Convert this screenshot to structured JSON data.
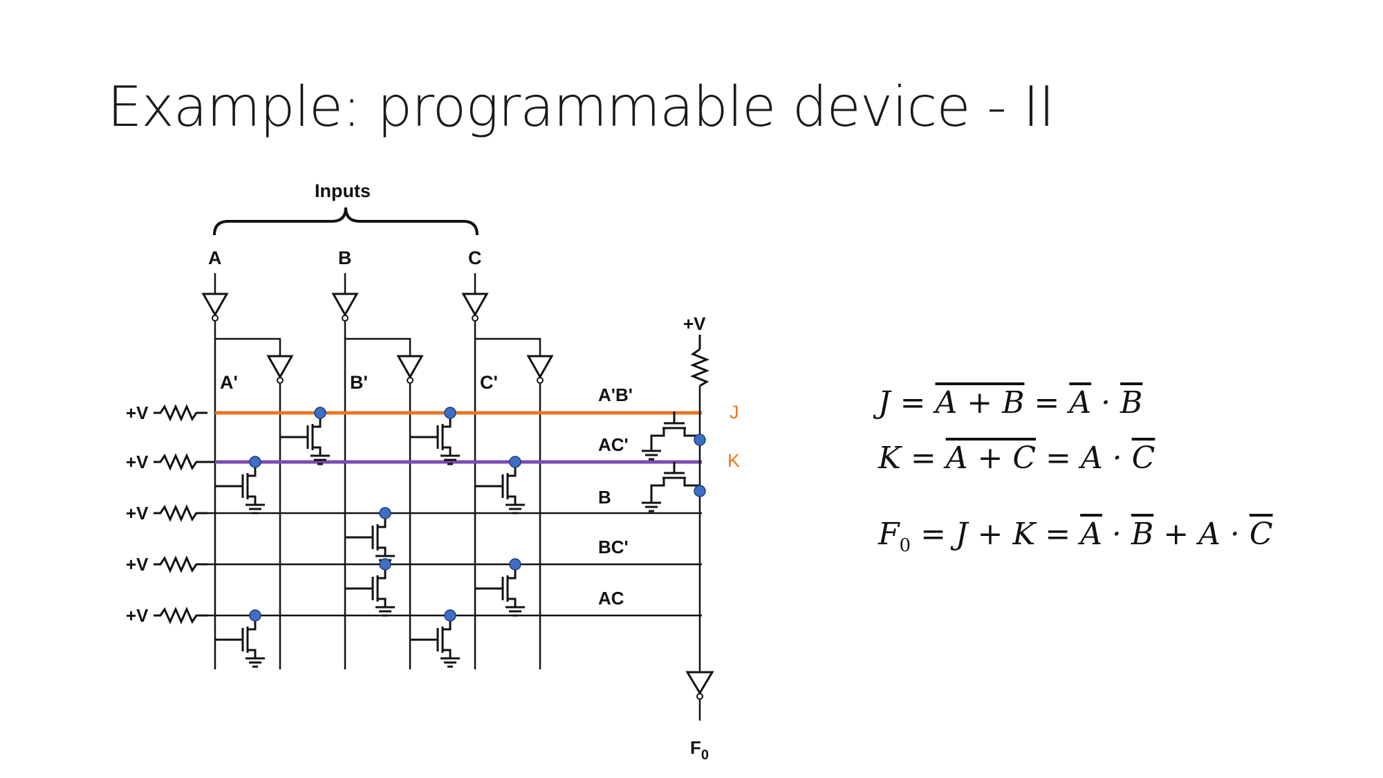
{
  "slide": {
    "title": "Example: programmable device - II"
  },
  "circuit": {
    "inputs_label": "Inputs",
    "input_names": [
      "A",
      "B",
      "C"
    ],
    "complement_names": [
      "A'",
      "B'",
      "C'"
    ],
    "supply_label": "+V",
    "output_label": "F",
    "output_subscript": "0",
    "row_labels": [
      "A'B'",
      "AC'",
      "B",
      "BC'",
      "AC"
    ],
    "highlight_labels": {
      "j": "J",
      "k": "K"
    },
    "colors": {
      "j_line": "#e87722",
      "k_line": "#7a4bb0",
      "fuse_dot": "#3f6fc4",
      "wire": "#111111"
    }
  },
  "equations": {
    "j": {
      "lhs": "J",
      "a_plus_b": "A + B",
      "a": "A",
      "b": "B"
    },
    "k": {
      "lhs": "K",
      "a_plus_c": "A + C",
      "a": "A",
      "c": "C"
    },
    "f": {
      "lhs": "F",
      "sub": "0",
      "mid": "J + K",
      "a": "A",
      "b": "B",
      "a2": "A",
      "c": "C"
    }
  }
}
